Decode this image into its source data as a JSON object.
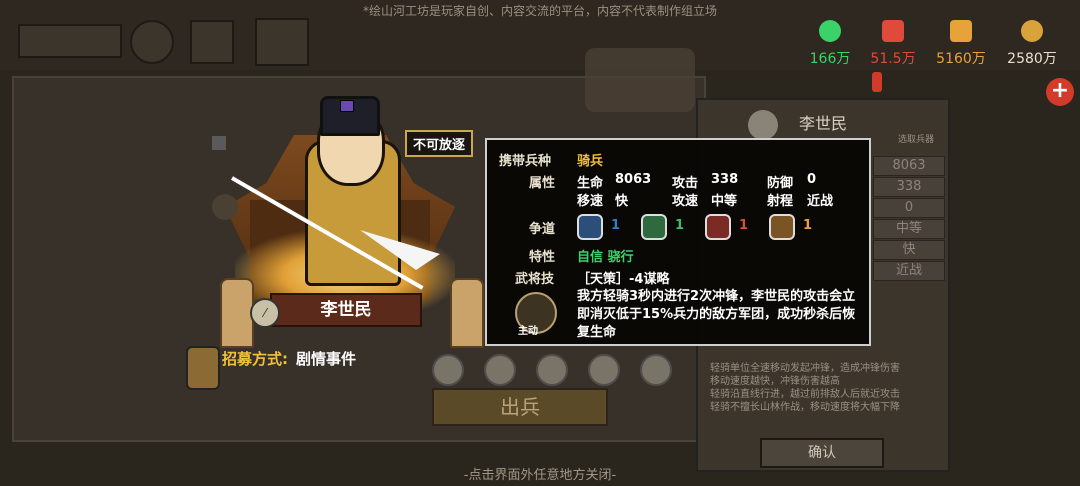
{
  "notice": "*绘山河工坊是玩家自创、内容交流的平台，内容不代表制作组立场",
  "resources": [
    {
      "icon": "soldier-icon",
      "value": "166万",
      "color": "#39d36a"
    },
    {
      "icon": "pickaxe-icon",
      "value": "51.5万",
      "color": "#e04a3a"
    },
    {
      "icon": "wheat-icon",
      "value": "5160万",
      "color": "#e8a23a"
    },
    {
      "icon": "coin-icon",
      "value": "2580万",
      "color": "#d9a23a"
    }
  ],
  "right_panel": {
    "name": "李世民",
    "select_label": "选取兵器",
    "stats": [
      "8063",
      "338",
      "0",
      "中等",
      "快",
      "近战"
    ],
    "desc_lines": [
      "轻骑单位全速移动发起冲锋，造成冲锋伤害",
      "移动速度越快，冲锋伤害越高",
      "轻骑沿直线行进，越过前排敌人后就近攻击",
      "轻骑不擅长山林作战，移动速度将大幅下降"
    ],
    "confirm": "确认"
  },
  "hero": {
    "tag": "不可放逐",
    "name": "李世民",
    "recruit_label": "招募方式:",
    "recruit_value": "剧情事件"
  },
  "info": {
    "troop_label": "携带兵种",
    "troop_value": "骑兵",
    "attr_label": "属性",
    "hp_label": "生命",
    "hp_value": "8063",
    "atk_label": "攻击",
    "atk_value": "338",
    "def_label": "防御",
    "def_value": "0",
    "spd_label": "移速",
    "spd_value": "快",
    "atkspd_label": "攻速",
    "atkspd_value": "中等",
    "range_label": "射程",
    "range_value": "近战",
    "dao_label": "争道",
    "dao": [
      {
        "icon": "water-icon",
        "value": "1",
        "color": "#3a7ad2",
        "bg": "#2b4f7a"
      },
      {
        "icon": "leaf-icon",
        "value": "1",
        "color": "#39c26a",
        "bg": "#2f6a3e"
      },
      {
        "icon": "fire-icon",
        "value": "1",
        "color": "#e04a3a",
        "bg": "#7a2b24"
      },
      {
        "icon": "mountain-icon",
        "value": "1",
        "color": "#e8a23a",
        "bg": "#7a5424"
      }
    ],
    "trait_label": "特性",
    "trait_value": "自信 骁行",
    "skill_label": "武将技",
    "skill_title": "［天策］-4谋略",
    "skill_desc": "我方轻骑3秒内进行2次冲锋，李世民的攻击会立即消灭低于15%兵力的敌方军团，成功秒杀后恢复生命",
    "skill_type": "主动"
  },
  "deploy_label": "出兵",
  "close_hint": "-点击界面外任意地方关闭-"
}
